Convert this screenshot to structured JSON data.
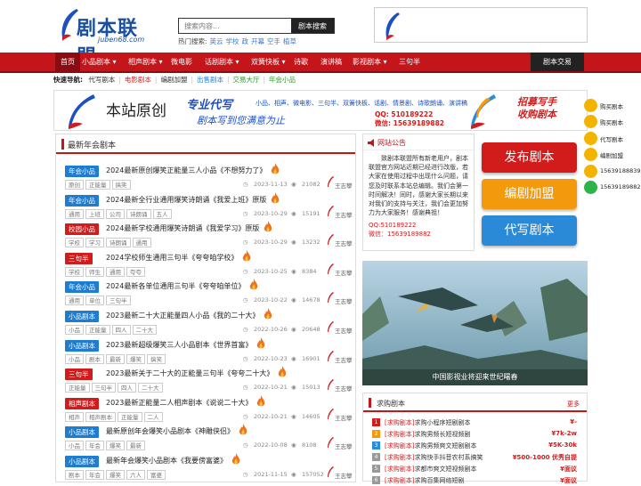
{
  "header": {
    "logo_text": "剧本联盟",
    "logo_url": "juben68.com",
    "search_placeholder": "搜索内容...",
    "search_button": "剧本搜索",
    "hot_label": "热门搜索:",
    "hot_terms": [
      "英云",
      "学校",
      "政",
      "开幕",
      "空手",
      "植草"
    ]
  },
  "nav": {
    "items": [
      "首页",
      "小品剧本",
      "相声剧本",
      "微电影",
      "话剧剧本",
      "双簧快板",
      "诗歌",
      "演讲稿",
      "影视剧本",
      "三句半"
    ],
    "dropdown_flags": [
      false,
      true,
      true,
      false,
      true,
      true,
      false,
      false,
      true,
      false
    ],
    "right_button": "剧本交易"
  },
  "quick": {
    "label": "快速导航:",
    "links": [
      "代写剧本",
      "电影剧本",
      "编剧加盟",
      "出售剧本",
      "交易大厅",
      "年会小品"
    ],
    "colors": [
      "#333333",
      "#d21c1c",
      "#333333",
      "#1e7dd0",
      "#2a9a2a",
      "#2a9a2a"
    ]
  },
  "banner": {
    "line1": "本站原创",
    "line2": "专业代写",
    "line3": "小品、相声、微电影、三句半、双簧快板、话剧、情景剧、诗歌朗诵、演讲稿",
    "line4": "剧本写到您满意为止",
    "qq": "QQ: 510189222",
    "wechat": "微信: 15639189882",
    "right1": "招募写手",
    "right2": "收购剧本"
  },
  "main": {
    "heading": "最新年会剧本",
    "entries": [
      {
        "cat": "年会小品",
        "title": "2024最新原创爆笑正能量三人小品《不想努力了》",
        "tags": [
          "原创",
          "正能量",
          "搞笑"
        ],
        "date": "2023-11-13",
        "views": "21082",
        "author": "王志攀"
      },
      {
        "cat": "年会小品",
        "title": "2024最新全行业通用爆笑诗朗诵《我爱上班》原版",
        "tags": [
          "通用",
          "上班",
          "公司",
          "诗朗诵",
          "五人"
        ],
        "date": "2023-10-29",
        "views": "15191",
        "author": "王志攀"
      },
      {
        "cat": "校园小品",
        "title": "2024最新学校通用爆笑诗朗诵《我爱学习》原版",
        "tags": [
          "学校",
          "学习",
          "诗朗诵",
          "通用"
        ],
        "date": "2023-10-29",
        "views": "13232",
        "author": "王志攀"
      },
      {
        "cat": "三句半",
        "title": "2024学校师生通用三句半《夸夸咱学校》",
        "tags": [
          "学校",
          "师生",
          "通用",
          "夸夸"
        ],
        "date": "2023-10-25",
        "views": "8384",
        "author": "王志攀"
      },
      {
        "cat": "年会小品",
        "title": "2024最新各单位通用三句半《夸夸咱单位》",
        "tags": [
          "通用",
          "单位",
          "三句半"
        ],
        "date": "2023-10-22",
        "views": "14678",
        "author": "王志攀"
      },
      {
        "cat": "小品剧本",
        "title": "2023最新二十大正能量四人小品《我的二十大》",
        "tags": [
          "小品",
          "正能量",
          "四人",
          "二十大"
        ],
        "date": "2022-10-26",
        "views": "20648",
        "author": "王志攀"
      },
      {
        "cat": "小品剧本",
        "title": "2023最新超级爆笑三人小品剧本《世界首富》",
        "tags": [
          "小品",
          "剧本",
          "最新",
          "爆笑",
          "搞笑"
        ],
        "date": "2022-10-23",
        "views": "16901",
        "author": "王志攀"
      },
      {
        "cat": "三句半",
        "title": "2023最新关于二十大的正能量三句半《夸夸二十大》",
        "tags": [
          "正能量",
          "三句半",
          "四人",
          "二十大"
        ],
        "date": "2022-10-21",
        "views": "15013",
        "author": "王志攀"
      },
      {
        "cat": "相声剧本",
        "title": "2023最新正能量二人相声剧本《说说二十大》",
        "tags": [
          "相声",
          "相声剧本",
          "正能量",
          "二人"
        ],
        "date": "2022-10-21",
        "views": "14605",
        "author": "王志攀"
      },
      {
        "cat": "小品剧本",
        "title": "最新原创年会爆笑小品剧本《神雕侠侣》",
        "tags": [
          "小品",
          "年会",
          "爆笑",
          "最新"
        ],
        "date": "2022-10-08",
        "views": "8108",
        "author": "王志攀"
      },
      {
        "cat": "小品剧本",
        "title": "最新年会爆笑小品剧本《我要傍富婆》",
        "tags": [
          "剧本",
          "年会",
          "爆笑",
          "六人",
          "富婆"
        ],
        "date": "2021-11-15",
        "views": "157052",
        "author": "王志攀"
      }
    ]
  },
  "notice": {
    "title": "网站公告",
    "body": "致剧本联盟所有新老用户，剧本联盟官方网站近期已经进行改版，若大家在使用过程中出现什么问题，请您及时联系本站总编辑。我们会第一时间解决！同时，感谢大家长期以来对我们的支持与关注，我们会更加努力为大家服务！感谢典祖！",
    "qq": "QQ:510189222",
    "wechat": "微信：15639189882"
  },
  "buttons": {
    "publish": "发布剧本",
    "join": "编剧加盟",
    "ghost": "代写剧本",
    "colors": [
      "#d21c1c",
      "#f29a0c",
      "#2b8ad8"
    ]
  },
  "side_icons": [
    "购买剧本",
    "购买剧本",
    "代写剧本",
    "编剧加盟",
    "15639188839",
    "15639189882"
  ],
  "photo": {
    "caption": "中国影视业将迎来世纪曙春"
  },
  "requests": {
    "title": "求购剧本",
    "more": "更多",
    "rows": [
      {
        "n": "1",
        "tag": "[求购剧本]",
        "text": "求购小程序短剧剧本",
        "price": "¥-"
      },
      {
        "n": "2",
        "tag": "[求购剧本]",
        "text": "求购男频长短视频剧",
        "price": "¥7k-2w"
      },
      {
        "n": "3",
        "tag": "[求购剧本]",
        "text": "求购男频爽文短剧剧本",
        "price": "¥5K-30k"
      },
      {
        "n": "4",
        "tag": "[求购剧本]",
        "text": "求购快手抖音农村系搞笑",
        "price": "¥500-1000 优秀自提"
      },
      {
        "n": "5",
        "tag": "[求购剧本]",
        "text": "求都市爽文短视频剧本",
        "price": "¥面议"
      },
      {
        "n": "6",
        "tag": "[求购剧本]",
        "text": "求购百集网络短剧",
        "price": "¥面议"
      }
    ]
  }
}
